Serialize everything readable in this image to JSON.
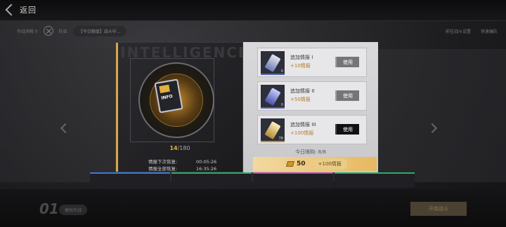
{
  "header": {
    "back_label": "返回"
  },
  "subbar": {
    "left_text": "作战消耗 0",
    "pill_text": "队伍",
    "notice": "【今日额度】战斗中…",
    "right_1": "前往战斗设置",
    "right_2": "快速编队"
  },
  "panel": {
    "watermark": "INTELLIGENCE",
    "card_label": "INFO",
    "current": "14",
    "max": "/180",
    "recovery": [
      {
        "label": "情报下次恢复:",
        "value": "00:05:26"
      },
      {
        "label": "情报全部恢复:",
        "value": "16:35:26"
      }
    ]
  },
  "items": [
    {
      "name": "追加情报 I",
      "gain": "+10情报",
      "qty": "0",
      "use": "使用",
      "enabled": false
    },
    {
      "name": "追加情报 II",
      "gain": "+50情报",
      "qty": "0",
      "use": "使用",
      "enabled": false
    },
    {
      "name": "追加情报 III",
      "gain": "+100情报",
      "qty": "78",
      "use": "使用",
      "enabled": true
    }
  ],
  "limit_text": "今日限购: 8/8",
  "buy": {
    "cost": "50",
    "label": "+100情报"
  },
  "bottom": {
    "stage": "01",
    "stage_btn": "模拟作战",
    "start": "开始战斗"
  },
  "colors": {
    "accent_gold": "#d6a84a",
    "use_enabled": "#111111",
    "use_disabled": "#757579"
  }
}
